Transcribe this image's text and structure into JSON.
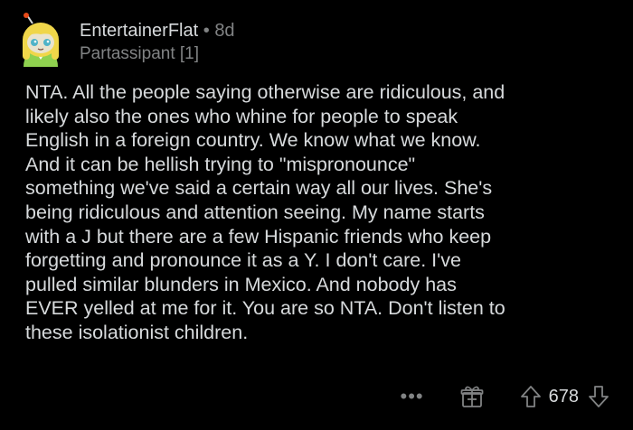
{
  "comment": {
    "author": "EntertainerFlat",
    "separator": "•",
    "age": "8d",
    "flair": "Partassipant [1]",
    "body": "NTA. All the people saying otherwise are ridiculous, and\nlikely also the ones who whine for people to speak\nEnglish in a foreign country. We know what we know.\nAnd it can be hellish trying to \"mispronounce\"\nsomething we've said a certain way all our lives. She's\nbeing ridiculous and attention seeing. My name starts\nwith a J but there are a few Hispanic friends who keep\nforgetting and pronounce it as a Y. I don't care. I've\npulled similar blunders in Mexico. And nobody has\nEVER yelled at me for it. You are so NTA. Don't listen to\nthese isolationist children.",
    "score": "678",
    "more_label": "•••"
  },
  "icons": {
    "avatar": "avatar-icon",
    "award": "award-icon",
    "upvote": "upvote-icon",
    "downvote": "downvote-icon"
  },
  "colors": {
    "background": "#000000",
    "text": "#d7dadc",
    "muted": "#818384",
    "avatar_hair": "#f0d64a",
    "avatar_body": "#8fd14f",
    "avatar_skin": "#e9e3cf"
  }
}
